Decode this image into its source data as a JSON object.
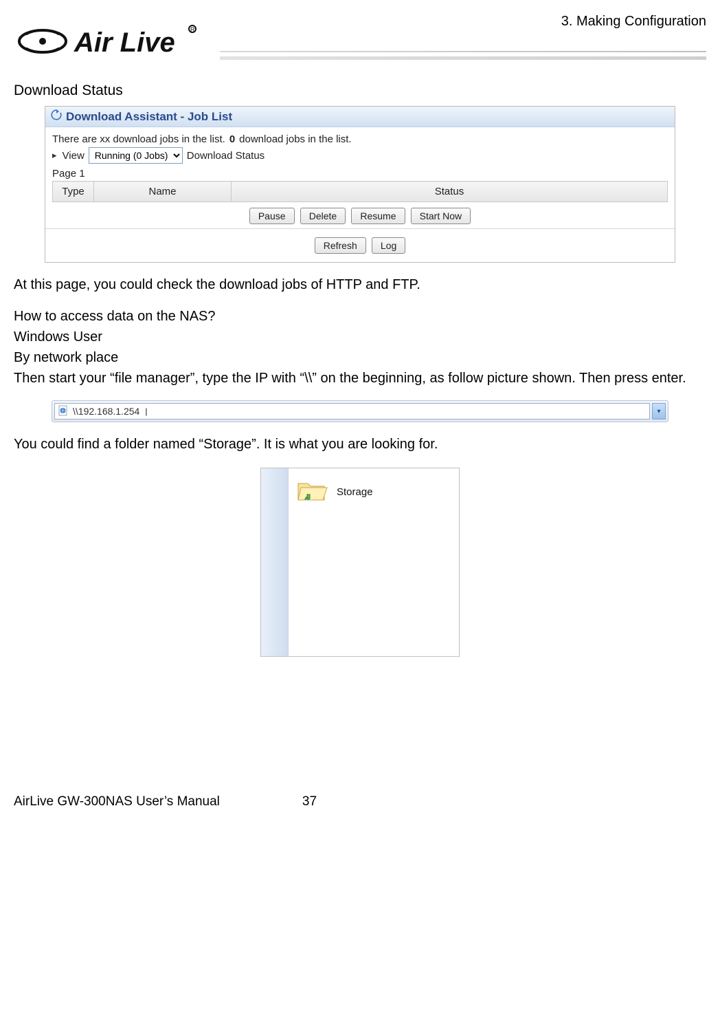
{
  "header": {
    "brand": "AirLive",
    "chapter": "3. Making Configuration"
  },
  "section_title": "Download Status",
  "panel": {
    "title": "Download Assistant - Job List",
    "status_prefix": "There are xx download jobs in the list. ",
    "status_bold": "0",
    "status_suffix": " download jobs in the list.",
    "view_label": "View",
    "view_select_value": "Running (0 Jobs)",
    "view_suffix": "Download Status",
    "page_indicator": "Page 1",
    "table": {
      "columns": [
        "Type",
        "Name",
        "Status"
      ]
    },
    "buttons_row1": [
      "Pause",
      "Delete",
      "Resume",
      "Start Now"
    ],
    "buttons_row2": [
      "Refresh",
      "Log"
    ]
  },
  "body": {
    "after_panel": "At this page, you could check the download jobs of HTTP and FTP.",
    "nas_heading": "How to access data on the NAS?",
    "nas_sub1": "Windows User",
    "nas_sub2": "By network place",
    "nas_instruction": "Then start your “file manager”, type the IP with “\\\\” on the beginning, as follow picture shown. Then press enter.",
    "storage_line": "You could find a folder named “Storage”. It is what you are looking for."
  },
  "address_bar": {
    "value": "\\\\192.168.1.254"
  },
  "explorer": {
    "folder_label": "Storage"
  },
  "footer": {
    "manual": "AirLive GW-300NAS User’s Manual",
    "page": "37"
  }
}
